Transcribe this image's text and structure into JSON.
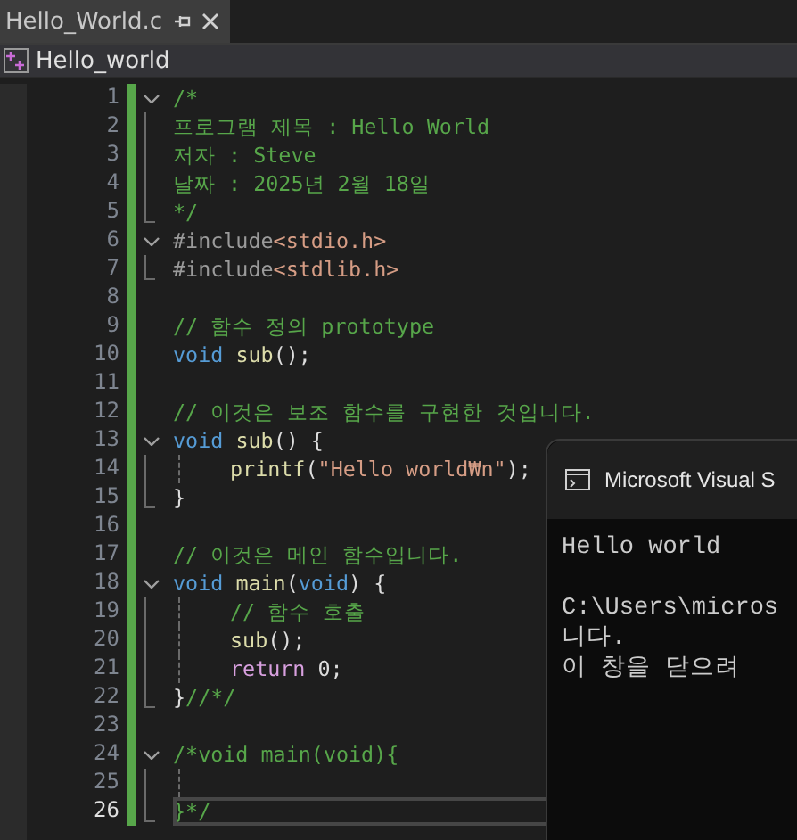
{
  "tabs": [
    {
      "label": "Hello_World.c",
      "selected": true
    }
  ],
  "nav": {
    "label": "Hello_world"
  },
  "editor": {
    "lines": [
      {
        "number": "1",
        "collapsible": true,
        "in_block": false,
        "indented": false,
        "current": false,
        "tokens": [
          {
            "kind": "comment",
            "text": "/*"
          }
        ]
      },
      {
        "number": "2",
        "collapsible": false,
        "in_block": true,
        "indented": false,
        "current": false,
        "tokens": [
          {
            "kind": "comment",
            "text": "프로그램 제목 : Hello World"
          }
        ]
      },
      {
        "number": "3",
        "collapsible": false,
        "in_block": true,
        "indented": false,
        "current": false,
        "tokens": [
          {
            "kind": "comment",
            "text": "저자 : Steve"
          }
        ]
      },
      {
        "number": "4",
        "collapsible": false,
        "in_block": true,
        "indented": false,
        "current": false,
        "tokens": [
          {
            "kind": "comment",
            "text": "날짜 : 2025년 2월 18일"
          }
        ]
      },
      {
        "number": "5",
        "collapsible": false,
        "in_block": true,
        "indented": false,
        "current": false,
        "tokens": [
          {
            "kind": "comment",
            "text": "*/"
          }
        ]
      },
      {
        "number": "6",
        "collapsible": true,
        "in_block": false,
        "indented": false,
        "current": false,
        "tokens": [
          {
            "kind": "preproc",
            "text": "#include"
          },
          {
            "kind": "string",
            "text": "<stdio.h>"
          }
        ]
      },
      {
        "number": "7",
        "collapsible": false,
        "in_block": true,
        "indented": false,
        "current": false,
        "tokens": [
          {
            "kind": "preproc",
            "text": "#include"
          },
          {
            "kind": "string",
            "text": "<stdlib.h>"
          }
        ]
      },
      {
        "number": "8",
        "collapsible": false,
        "in_block": false,
        "indented": false,
        "current": false
      },
      {
        "number": "9",
        "collapsible": false,
        "in_block": false,
        "indented": false,
        "current": false,
        "tokens": [
          {
            "kind": "comment",
            "text": "// 함수 정의 prototype"
          }
        ]
      },
      {
        "number": "10",
        "collapsible": false,
        "in_block": false,
        "indented": false,
        "current": false,
        "tokens": [
          {
            "kind": "keyword",
            "text": "void"
          },
          {
            "kind": "function",
            "text": " sub"
          },
          {
            "kind": "plain",
            "text": "();"
          }
        ]
      },
      {
        "number": "11",
        "collapsible": false,
        "in_block": false,
        "indented": false,
        "current": false
      },
      {
        "number": "12",
        "collapsible": false,
        "in_block": false,
        "indented": false,
        "current": false,
        "tokens": [
          {
            "kind": "comment",
            "text": "// 이것은 보조 함수를 구현한 것입니다."
          }
        ]
      },
      {
        "number": "13",
        "collapsible": true,
        "in_block": false,
        "indented": false,
        "current": false,
        "tokens": [
          {
            "kind": "keyword",
            "text": "void"
          },
          {
            "kind": "function",
            "text": " sub"
          },
          {
            "kind": "plain",
            "text": "() {"
          }
        ]
      },
      {
        "number": "14",
        "collapsible": false,
        "in_block": true,
        "indented": true,
        "current": false,
        "tokens": [
          {
            "kind": "function",
            "text": "printf"
          },
          {
            "kind": "plain",
            "text": "("
          },
          {
            "kind": "string",
            "text": "\"Hello world₩n\""
          },
          {
            "kind": "plain",
            "text": ");"
          }
        ]
      },
      {
        "number": "15",
        "collapsible": false,
        "in_block": true,
        "indented": false,
        "current": false,
        "tokens": [
          {
            "kind": "plain",
            "text": "}"
          }
        ]
      },
      {
        "number": "16",
        "collapsible": false,
        "in_block": false,
        "indented": false,
        "current": false
      },
      {
        "number": "17",
        "collapsible": false,
        "in_block": false,
        "indented": false,
        "current": false,
        "tokens": [
          {
            "kind": "comment",
            "text": "// 이것은 메인 함수입니다."
          }
        ]
      },
      {
        "number": "18",
        "collapsible": true,
        "in_block": false,
        "indented": false,
        "current": false,
        "tokens": [
          {
            "kind": "keyword",
            "text": "void"
          },
          {
            "kind": "function",
            "text": " main"
          },
          {
            "kind": "plain",
            "text": "("
          },
          {
            "kind": "keyword",
            "text": "void"
          },
          {
            "kind": "plain",
            "text": ") {"
          }
        ]
      },
      {
        "number": "19",
        "collapsible": false,
        "in_block": true,
        "indented": true,
        "current": false,
        "tokens": [
          {
            "kind": "comment",
            "text": "// 함수 호출"
          }
        ]
      },
      {
        "number": "20",
        "collapsible": false,
        "in_block": true,
        "indented": true,
        "current": false,
        "tokens": [
          {
            "kind": "function",
            "text": "sub"
          },
          {
            "kind": "plain",
            "text": "();"
          }
        ]
      },
      {
        "number": "21",
        "collapsible": false,
        "in_block": true,
        "indented": true,
        "current": false,
        "tokens": [
          {
            "kind": "control",
            "text": "return"
          },
          {
            "kind": "plain",
            "text": " 0;"
          }
        ]
      },
      {
        "number": "22",
        "collapsible": false,
        "in_block": true,
        "indented": false,
        "current": false,
        "tokens": [
          {
            "kind": "plain",
            "text": "}"
          },
          {
            "kind": "comment",
            "text": "//*/"
          }
        ]
      },
      {
        "number": "23",
        "collapsible": false,
        "in_block": false,
        "indented": false,
        "current": false
      },
      {
        "number": "24",
        "collapsible": true,
        "in_block": false,
        "indented": false,
        "current": false,
        "tokens": [
          {
            "kind": "comment",
            "text": "/*void main(void){"
          }
        ]
      },
      {
        "number": "25",
        "collapsible": false,
        "in_block": true,
        "indented": true,
        "current": false
      },
      {
        "number": "26",
        "collapsible": false,
        "in_block": true,
        "indented": false,
        "current": true,
        "tokens": [
          {
            "kind": "comment",
            "text": "}*/"
          }
        ]
      }
    ]
  },
  "console": {
    "title": "Microsoft Visual S",
    "lines": [
      "Hello world",
      "C:\\Users\\micros",
      "니다.",
      "이 창을 닫으려"
    ]
  }
}
